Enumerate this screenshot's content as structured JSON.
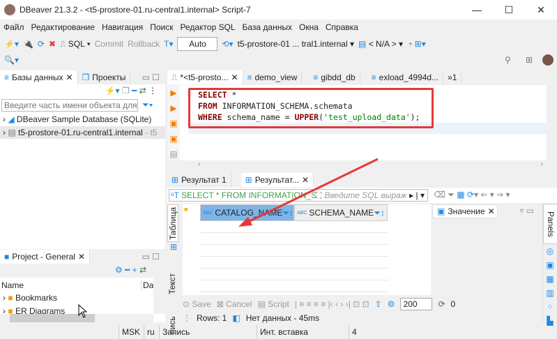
{
  "window": {
    "title": "DBeaver 21.3.2 - <t5-prostore-01.ru-central1.internal> Script-7",
    "minimize": "—",
    "maximize": "☐",
    "close": "✕"
  },
  "menu": [
    "Файл",
    "Редактирование",
    "Навигация",
    "Поиск",
    "Редактор SQL",
    "База данных",
    "Окна",
    "Справка"
  ],
  "toolbar": {
    "sql": "SQL",
    "commit": "Commit",
    "rollback": "Rollback",
    "mode": "Auto",
    "connection": "t5-prostore-01 ... tral1.internal",
    "schema": "< N/A >"
  },
  "left": {
    "tabs": [
      "Базы данных",
      "Проекты"
    ],
    "filter_placeholder": "Введите часть имени объекта для по",
    "tree": [
      {
        "label": "DBeaver Sample Database (SQLite)"
      },
      {
        "label": "t5-prostore-01.ru-central1.internal",
        "suffix": "- t5"
      }
    ]
  },
  "project": {
    "title": "Project - General",
    "columns": [
      "Name",
      "Da"
    ],
    "items": [
      "Bookmarks",
      "ER Diagrams"
    ]
  },
  "editor": {
    "tabs": [
      "*<t5-prosto...",
      "demo_view",
      "gibdd_db",
      "exload_4994d...",
      "»1"
    ],
    "lines": [
      [
        {
          "k": "SELECT"
        },
        {
          "t": " *"
        }
      ],
      [
        {
          "k": "FROM"
        },
        {
          "t": " INFORMATION_SCHEMA.schemata"
        }
      ],
      [
        {
          "k": "WHERE"
        },
        {
          "t": " schema_name = "
        },
        {
          "k": "UPPER"
        },
        {
          "t": "("
        },
        {
          "s": "'test_upload_data'"
        },
        {
          "t": ");"
        }
      ]
    ]
  },
  "results": {
    "tabs": [
      "Результат 1",
      "Результат..."
    ],
    "query": "SELECT * FROM INFORMATION_SCH",
    "filter_placeholder": "Введите SQL выраж",
    "columns": [
      "CATALOG_NAME",
      "SCHEMA_NAME"
    ],
    "side_tabs": [
      "Таблица",
      "Текст",
      "пись"
    ],
    "value_panel": "Значение",
    "panels": "Panels",
    "bottom": {
      "save": "Save",
      "cancel": "Cancel",
      "script": "Script",
      "limit": "200",
      "count": "0"
    },
    "rows": "Rows: 1",
    "status": "Нет данных - 45ms"
  },
  "statusbar": [
    "MSK",
    "ru",
    "Запись",
    "Инт. вставка",
    "4"
  ],
  "colors": {
    "accent": "#1e88e5",
    "annotation": "#e53935",
    "keyword": "#8b0000",
    "string": "#008000",
    "selected_column": "#7fb5e6"
  }
}
